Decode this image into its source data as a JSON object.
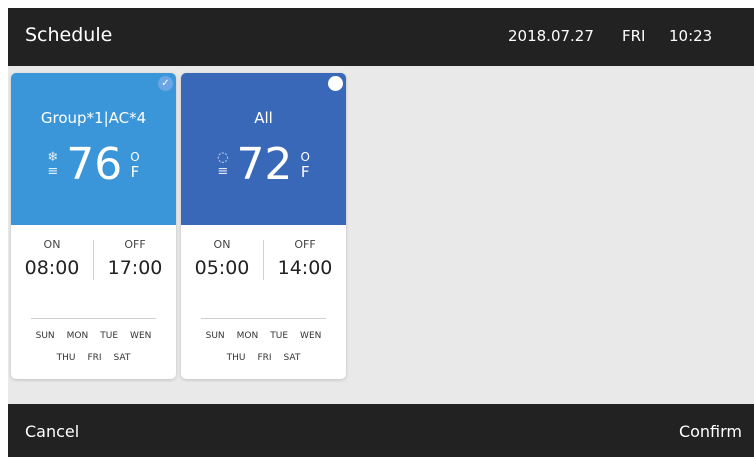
{
  "header": {
    "title": "Schedule",
    "date": "2018.07.27",
    "day": "FRI",
    "time": "10:23"
  },
  "cards": [
    {
      "name": "Group*1|AC*4",
      "selected": true,
      "color": "#3a96d8",
      "mode_icon": "snowflake-icon",
      "mode_glyph": "❄",
      "fan_glyph": "≡",
      "temperature": "76",
      "unit_degree": "O",
      "unit": "F",
      "on_label": "ON",
      "off_label": "OFF",
      "on_time": "08:00",
      "off_time": "17:00",
      "days_row1": [
        "SUN",
        "MON",
        "TUE",
        "WEN"
      ],
      "days_row2": [
        "THU",
        "FRI",
        "SAT"
      ]
    },
    {
      "name": "All",
      "selected": false,
      "color": "#3a68b8",
      "mode_icon": "auto-mode-icon",
      "mode_glyph": "◌",
      "fan_glyph": "≡",
      "temperature": "72",
      "unit_degree": "O",
      "unit": "F",
      "on_label": "ON",
      "off_label": "OFF",
      "on_time": "05:00",
      "off_time": "14:00",
      "days_row1": [
        "SUN",
        "MON",
        "TUE",
        "WEN"
      ],
      "days_row2": [
        "THU",
        "FRI",
        "SAT"
      ]
    }
  ],
  "footer": {
    "cancel": "Cancel",
    "confirm": "Confirm"
  }
}
